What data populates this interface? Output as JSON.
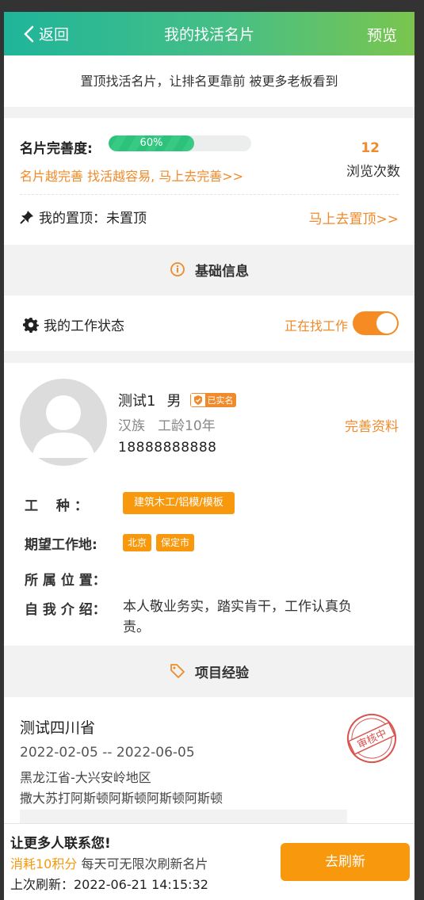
{
  "header": {
    "back_label": "返回",
    "title": "我的找活名片",
    "preview_label": "预览"
  },
  "banner": {
    "text": "置顶找活名片，让排名更靠前 被更多老板看到"
  },
  "stats": {
    "completeness_label": "名片完善度:",
    "completeness_percent": 60,
    "completeness_text": "60%",
    "completeness_tip": "名片越完善 找活越容易, 马上去完善>>",
    "views_count": "12",
    "views_label": "浏览次数",
    "pin_label": "我的置顶：未置顶",
    "pin_link": "马上去置顶>>"
  },
  "basic_section": {
    "title": "基础信息"
  },
  "work_status": {
    "label": "我的工作状态",
    "state": "正在找工作",
    "toggle_on": true
  },
  "profile": {
    "name": "测试1",
    "gender": "男",
    "verified_badge": "已实名",
    "ethnicity": "汉族",
    "experience": "工龄10年",
    "edit_link": "完善资料",
    "phone": "18888888888",
    "trade_label": "工　 种 ：",
    "trades": [
      "建筑木工/铝模/模板"
    ],
    "location_label": "期望工作地:",
    "locations": [
      "北京",
      "保定市"
    ],
    "position_label": "所 属 位 置：",
    "intro_label": "自 我 介 绍：",
    "intro": "本人敬业务实，踏实肯干，工作认真负责。"
  },
  "project_section": {
    "title": "项目经验"
  },
  "project": {
    "title": "测试四川省",
    "dates": "2022-02-05 -- 2022-06-05",
    "location": "黑龙江省-大兴安岭地区",
    "description": "撒大苏打阿斯顿阿斯顿阿斯顿阿斯顿",
    "stamp": "审核中"
  },
  "footer": {
    "headline": "让更多人联系您!",
    "cost": "消耗10积分",
    "cost_suffix": " 每天可无限次刷新名片",
    "last_refresh": "上次刷新：2022-06-21 14:15:32",
    "refresh_button": "去刷新"
  },
  "colors": {
    "accent": "#f08a2a",
    "button": "#f8980d",
    "header_start": "#1fb59a",
    "header_end": "#7ac54e",
    "progress": "#2cc27b"
  }
}
